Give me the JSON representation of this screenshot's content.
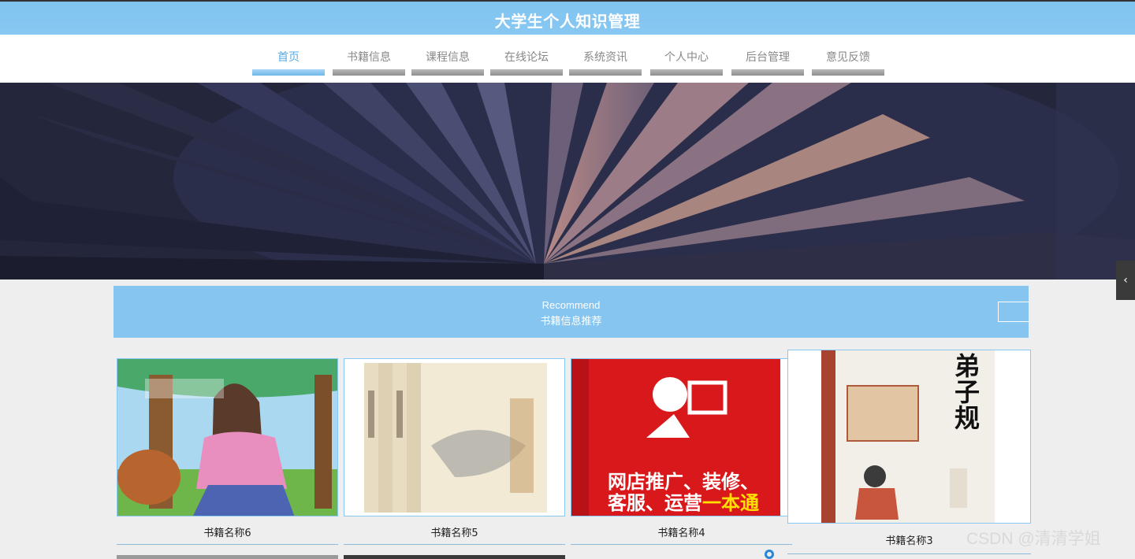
{
  "header": {
    "title": "大学生个人知识管理"
  },
  "nav": {
    "items": [
      {
        "label": "首页"
      },
      {
        "label": "书籍信息"
      },
      {
        "label": "课程信息"
      },
      {
        "label": "在线论坛"
      },
      {
        "label": "系统资讯"
      },
      {
        "label": "个人中心"
      },
      {
        "label": "后台管理"
      },
      {
        "label": "意见反馈"
      }
    ],
    "active_index": 0
  },
  "recommend": {
    "en": "Recommend",
    "cn": "书籍信息推荐"
  },
  "books": [
    {
      "name": "书籍名称6"
    },
    {
      "name": "书籍名称5"
    },
    {
      "name": "书籍名称4",
      "cover_text": [
        "网店推广、装修、",
        "客服、运营",
        "一本通"
      ]
    },
    {
      "name": "书籍名称3",
      "cover_text": [
        "弟",
        "子",
        "规"
      ]
    }
  ],
  "side_tab": {
    "label": "‹"
  },
  "watermark": "CSDN @清清学姐",
  "colors": {
    "accent": "#86c5f0",
    "nav_active": "#5aaae0",
    "nav_inactive": "#888888"
  }
}
